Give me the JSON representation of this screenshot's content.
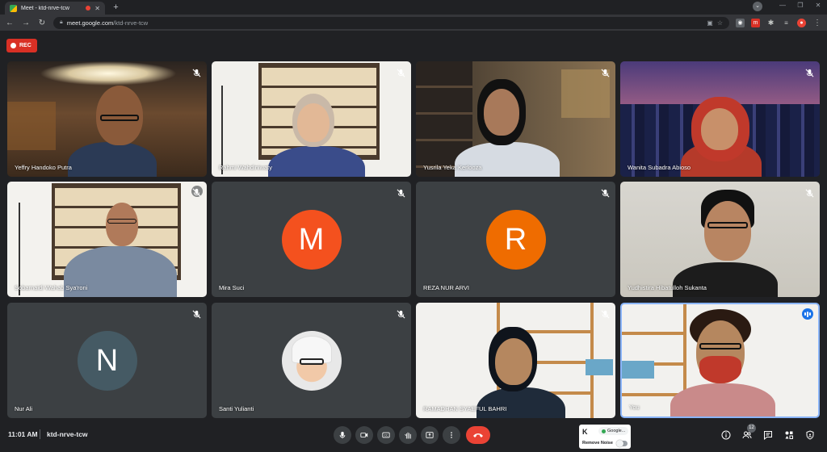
{
  "browser": {
    "tab_title": "Meet - ktd-nrve-tcw",
    "url_host": "meet.google.com",
    "url_path": "/ktd-nrve-tcw",
    "new_tab": "+"
  },
  "meet": {
    "rec_label": "REC",
    "clock": "11:01 AM",
    "meeting_code": "ktd-nrve-tcw",
    "people_count": "12",
    "colors": {
      "accent": "#1a73e8",
      "end_call": "#ea4335",
      "rec": "#d93025",
      "tile": "#3c4043"
    }
  },
  "participants": [
    {
      "name": "Yeffry Handoko Putra",
      "type": "video"
    },
    {
      "name": "Rahmi Wahdiniwaty",
      "type": "video"
    },
    {
      "name": "Yusrila Yeka Kerlooza",
      "type": "video"
    },
    {
      "name": "Wanita Subadra Abioso",
      "type": "video"
    },
    {
      "name": "Sobarnaidi Wahab Sya'roni",
      "type": "video"
    },
    {
      "name": "Mira Suci",
      "type": "avatar",
      "initial": "M",
      "color": "#f4511e"
    },
    {
      "name": "REZA NUR ARVI",
      "type": "avatar",
      "initial": "R",
      "color": "#ef6c00"
    },
    {
      "name": "Yudhistira Hibatulloh Sukanta",
      "type": "video"
    },
    {
      "name": "Nur Ali",
      "type": "avatar",
      "initial": "N",
      "color": "#455a64"
    },
    {
      "name": "Santi Yulianti",
      "type": "photo"
    },
    {
      "name": "RAMADHAN SYAEFUL BAHRI",
      "type": "video"
    },
    {
      "name": "You",
      "type": "video"
    }
  ],
  "noise_widget": {
    "logo": "K",
    "chip": "Google...",
    "label": "Remove Noise"
  }
}
